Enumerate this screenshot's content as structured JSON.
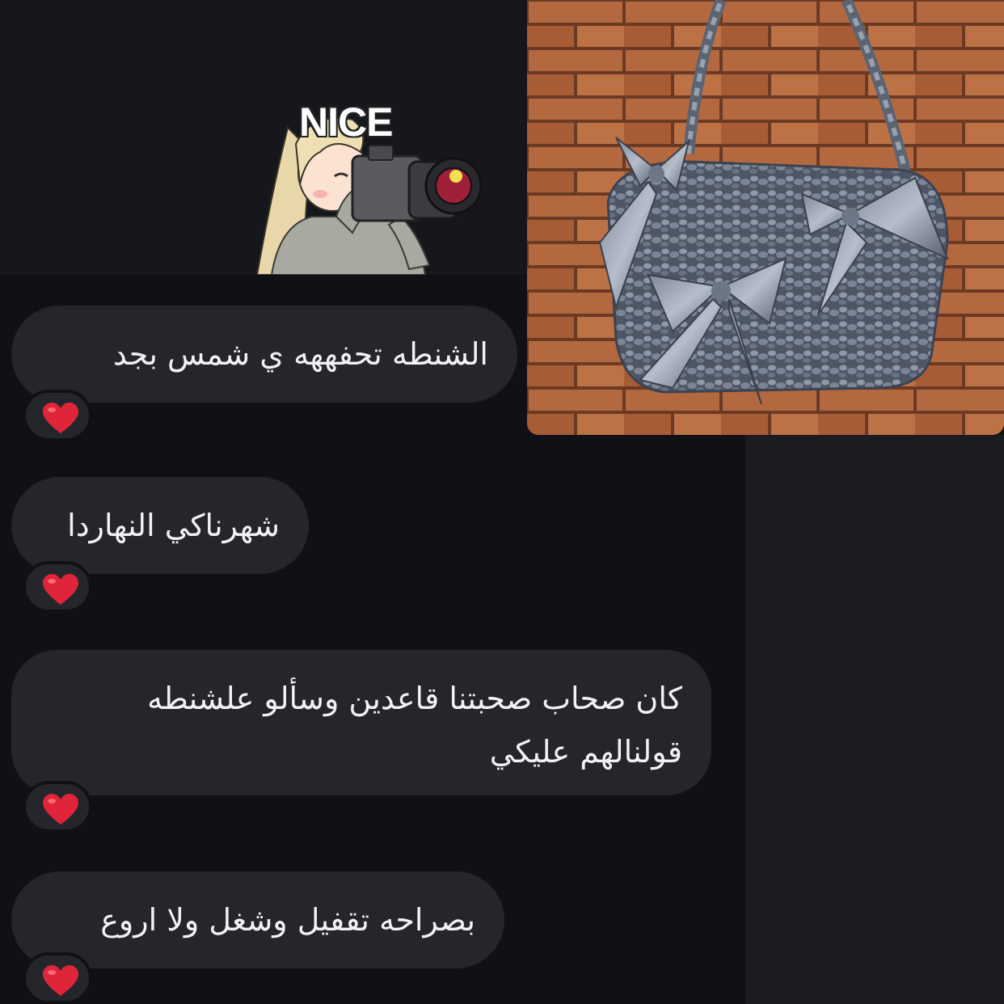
{
  "sticker": {
    "caption": "NICE"
  },
  "messages": [
    {
      "text": "الشنطه تحفههه ي شمس بجد",
      "reaction": "red-heart"
    },
    {
      "text": "شهرناكي النهاردا",
      "reaction": "red-heart"
    },
    {
      "text": "كان صحاب صحبتنا قاعدين وسألو علشنطه\nقولنالهم عليكي",
      "reaction": "red-heart"
    },
    {
      "text": "بصراحه تقفيل وشغل ولا اروع",
      "reaction": "red-heart"
    }
  ],
  "colors": {
    "background": "#0f1116",
    "bubble": "#24262c",
    "heart": "#e0243a"
  }
}
